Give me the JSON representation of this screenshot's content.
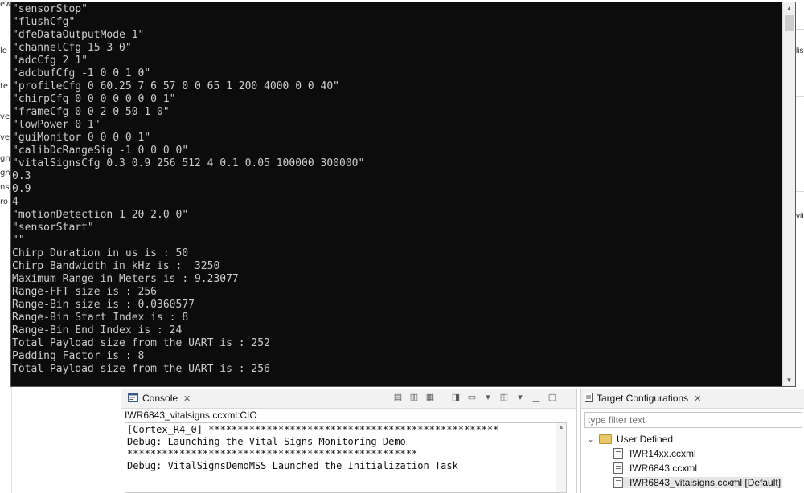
{
  "terminal": {
    "lines": [
      "\"sensorStop\"",
      "\"flushCfg\"",
      "\"dfeDataOutputMode 1\"",
      "\"channelCfg 15 3 0\"",
      "\"adcCfg 2 1\"",
      "\"adcbufCfg -1 0 0 1 0\"",
      "\"profileCfg 0 60.25 7 6 57 0 0 65 1 200 4000 0 0 40\"",
      "\"chirpCfg 0 0 0 0 0 0 0 1\"",
      "\"frameCfg 0 0 2 0 50 1 0\"",
      "\"lowPower 0 1\"",
      "\"guiMonitor 0 0 0 0 1\"",
      "\"calibDcRangeSig -1 0 0 0 0\"",
      "\"vitalSignsCfg 0.3 0.9 256 512 4 0.1 0.05 100000 300000\"",
      "0.3",
      "0.9",
      "4",
      "\"motionDetection 1 20 2.0 0\"",
      "\"sensorStart\"",
      "\"\"",
      "Chirp Duration in us is : 50",
      "Chirp Bandwidth in kHz is :  3250",
      "Maximum Range in Meters is : 9.23077",
      "Range-FFT size is : 256",
      "Range-Bin size is : 0.0360577",
      "Range-Bin Start Index is : 8",
      "Range-Bin End Index is : 24",
      "Total Payload size from the UART is : 252",
      "Padding Factor is : 8",
      "Total Payload size from the UART is : 256"
    ]
  },
  "background": {
    "left_fragments": [
      "ew",
      "lo",
      "te",
      "ve_",
      "ve_",
      "gns",
      "gns",
      "ns_",
      "ro"
    ],
    "right_fragments": [
      "lis",
      "vit"
    ]
  },
  "console": {
    "tab_label": "Console",
    "title": "IWR6843_vitalsigns.ccxml:CIO",
    "lines": [
      "[Cortex_R4_0] **************************************************",
      "Debug: Launching the Vital-Signs Monitoring Demo",
      "**************************************************",
      "Debug: VitalSignsDemoMSS Launched the Initialization Task"
    ],
    "toolbar_icons": [
      "clear-console-icon",
      "scroll-lock-icon",
      "word-wrap-icon",
      "pin-console-icon",
      "display-console-icon",
      "new-console-icon",
      "minimize-icon",
      "maximize-icon"
    ]
  },
  "target": {
    "tab_label": "Target Configurations",
    "filter_placeholder": "type filter text",
    "folder": "User Defined",
    "files": [
      "IWR14xx.ccxml",
      "IWR6843.ccxml",
      "IWR6843_vitalsigns.ccxml [Default]"
    ]
  },
  "colors": {
    "terminal_bg": "#0c0c0c",
    "terminal_text": "#cccccc"
  }
}
